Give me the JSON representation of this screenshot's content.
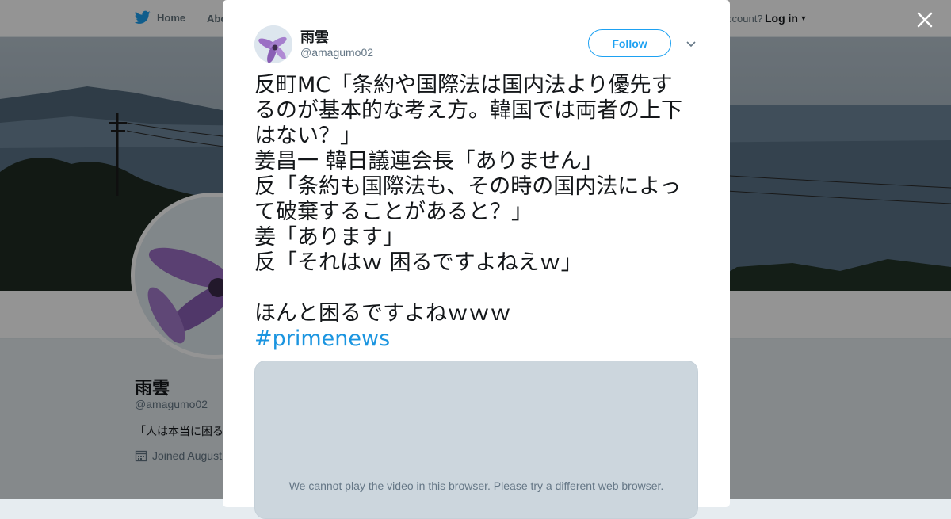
{
  "topbar": {
    "home_label": "Home",
    "about_label": "Abo",
    "account_text": "ccount?",
    "login_label": "Log in"
  },
  "profile": {
    "name": "雨雲",
    "handle": "@amagumo02",
    "bio": "「人は本当に困る",
    "joined": "Joined August"
  },
  "tweet": {
    "author_name": "雨雲",
    "author_handle": "@amagumo02",
    "follow_label": "Follow",
    "lines": [
      "反町MC「条約や国際法は国内法より優先す",
      "るのが基本的な考え方。韓国では両者の上下",
      "はない？」",
      "姜昌一 韓日議連会長「ありません」",
      "反「条約も国際法も、その時の国内法によっ",
      "て破棄することがあると？」",
      "姜「あります」",
      "反「それはｗ 困るですよねえｗ」",
      "",
      "ほんと困るですよねｗｗｗ"
    ],
    "hashtag": "#primenews",
    "video_message": "We cannot play the video in this browser. Please try a different web browser."
  },
  "icons": {
    "twitter_bird": "twitter-bird-icon",
    "close": "close-icon",
    "caret": "chevron-down-icon",
    "calendar": "calendar-icon"
  },
  "colors": {
    "accent": "#1da1f2",
    "hashtag": "#1b95e0",
    "text": "#14171a",
    "secondary": "#657786",
    "media_bg": "#ccd6dd"
  }
}
